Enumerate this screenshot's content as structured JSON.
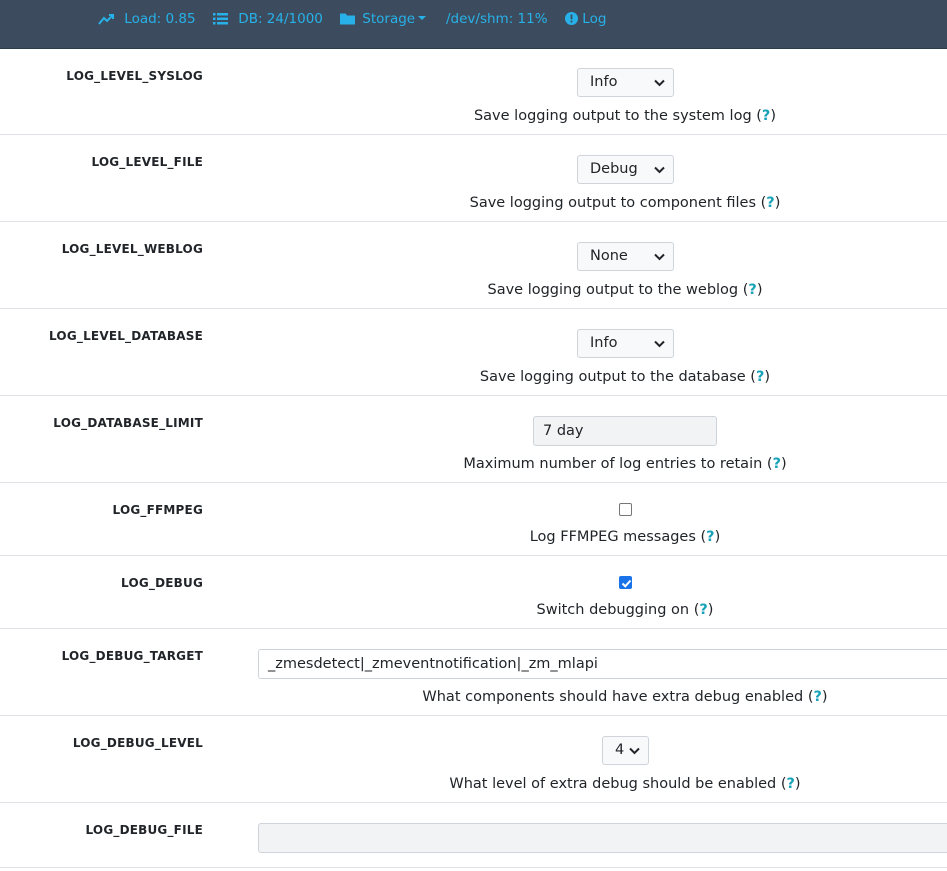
{
  "topbar": {
    "load": "Load: 0.85",
    "db": "DB: 24/1000",
    "storage": "Storage",
    "shm": "/dev/shm: 11%",
    "log": "Log",
    "icons": [
      "trending-up-icon",
      "list-icon",
      "folder-icon",
      "info-circle-icon"
    ],
    "accent": "#27b1e8",
    "background": "#3c4c5e"
  },
  "settings": [
    {
      "label": "LOG_LEVEL_SYSLOG",
      "type": "select",
      "value": "Info",
      "desc": "Save logging output to the system log (",
      "help": "?",
      "close": ")"
    },
    {
      "label": "LOG_LEVEL_FILE",
      "type": "select",
      "value": "Debug",
      "desc": "Save logging output to component files (",
      "help": "?",
      "close": ")"
    },
    {
      "label": "LOG_LEVEL_WEBLOG",
      "type": "select",
      "value": "None",
      "desc": "Save logging output to the weblog (",
      "help": "?",
      "close": ")"
    },
    {
      "label": "LOG_LEVEL_DATABASE",
      "type": "select",
      "value": "Info",
      "desc": "Save logging output to the database (",
      "help": "?",
      "close": ")"
    },
    {
      "label": "LOG_DATABASE_LIMIT",
      "type": "text",
      "value": "7 day",
      "desc": "Maximum number of log entries to retain (",
      "help": "?",
      "close": ")"
    },
    {
      "label": "LOG_FFMPEG",
      "type": "checkbox",
      "checked": false,
      "desc": "Log FFMPEG messages (",
      "help": "?",
      "close": ")"
    },
    {
      "label": "LOG_DEBUG",
      "type": "checkbox",
      "checked": true,
      "desc": "Switch debugging on (",
      "help": "?",
      "close": ")"
    },
    {
      "label": "LOG_DEBUG_TARGET",
      "type": "text",
      "value": "_zmesdetect|_zmeventnotification|_zm_mlapi",
      "desc": "What components should have extra debug enabled (",
      "help": "?",
      "close": ")"
    },
    {
      "label": "LOG_DEBUG_LEVEL",
      "type": "select",
      "value": "4",
      "desc": "What level of extra debug should be enabled (",
      "help": "?",
      "close": ")"
    },
    {
      "label": "LOG_DEBUG_FILE",
      "type": "text",
      "value": ""
    }
  ]
}
